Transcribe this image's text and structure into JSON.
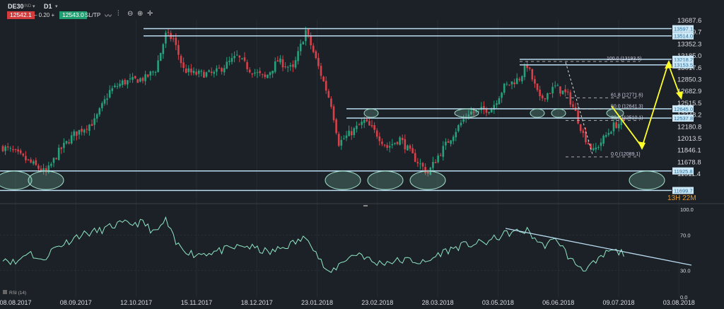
{
  "toolbar": {
    "symbol": "DE30",
    "market": "IND",
    "timeframe": "D1",
    "sell_price": "12542.1",
    "spread": "– 0.20 +",
    "buy_price": "12543.0",
    "sltp": "SL/TP"
  },
  "countdown": "13H 22M",
  "chart_data": [
    {
      "type": "candlestick",
      "title": "DE30 D1",
      "y_ticks": [
        "13687.6",
        "13519.7",
        "13352.3",
        "13185.0",
        "13017.6",
        "12850.3",
        "12682.9",
        "12515.5",
        "12348.2",
        "12180.8",
        "12013.5",
        "11846.1",
        "11678.8",
        "11511.4"
      ],
      "ylim": [
        11511.4,
        13687.6
      ],
      "x_ticks": [
        "08.08.2017",
        "08.09.2017",
        "12.10.2017",
        "15.11.2017",
        "18.12.2017",
        "23.01.2018",
        "23.02.2018",
        "28.03.2018",
        "03.05.2018",
        "06.06.2018",
        "09.07.2018",
        "03.08.2018"
      ],
      "close_waypoints": [
        [
          0,
          12200
        ],
        [
          4,
          12150
        ],
        [
          12,
          12000
        ],
        [
          17,
          11900
        ],
        [
          22,
          12150
        ],
        [
          28,
          12350
        ],
        [
          36,
          12500
        ],
        [
          42,
          12850
        ],
        [
          47,
          12950
        ],
        [
          56,
          13000
        ],
        [
          60,
          13100
        ],
        [
          64,
          13500
        ],
        [
          67,
          13450
        ],
        [
          71,
          13100
        ],
        [
          75,
          13050
        ],
        [
          83,
          13050
        ],
        [
          92,
          13250
        ],
        [
          97,
          13100
        ],
        [
          103,
          13000
        ],
        [
          108,
          13200
        ],
        [
          114,
          13100
        ],
        [
          119,
          13550
        ],
        [
          122,
          13300
        ],
        [
          129,
          12700
        ],
        [
          132,
          12250
        ],
        [
          136,
          12350
        ],
        [
          142,
          12500
        ],
        [
          147,
          12350
        ],
        [
          151,
          12200
        ],
        [
          156,
          12300
        ],
        [
          161,
          12100
        ],
        [
          167,
          11900
        ],
        [
          171,
          12100
        ],
        [
          178,
          12400
        ],
        [
          183,
          12600
        ],
        [
          192,
          12650
        ],
        [
          197,
          12900
        ],
        [
          203,
          13000
        ],
        [
          206,
          13150
        ],
        [
          211,
          12750
        ],
        [
          217,
          12900
        ],
        [
          222,
          12800
        ],
        [
          225,
          12600
        ],
        [
          228,
          12350
        ],
        [
          232,
          12150
        ],
        [
          236,
          12300
        ],
        [
          240,
          12450
        ],
        [
          244,
          12500
        ]
      ],
      "horizontal_levels": [
        {
          "label": "13597.1",
          "price": 13597.1
        },
        {
          "label": "13514.0",
          "price": 13514.0
        },
        {
          "label": "13218.2",
          "price": 13218.2
        },
        {
          "label": "13153.5",
          "price": 13153.5
        },
        {
          "label": "12645.0",
          "price": 12645.0
        },
        {
          "label": "12537.8",
          "price": 12537.8
        },
        {
          "label": "11925.8",
          "price": 11925.8
        },
        {
          "label": "11699.7",
          "price": 11699.7
        }
      ],
      "fibonacci": [
        {
          "label": "100.0 (13193.5)",
          "price": 13193.5
        },
        {
          "label": "61.8 (12771.6)",
          "price": 12771.6
        },
        {
          "label": "50.0 (12641.3)",
          "price": 12641.3
        },
        {
          "label": "38.2 (12510.1)",
          "price": 12510.1
        },
        {
          "label": "0.0 (12089.1)",
          "price": 12089.1
        }
      ],
      "colors": {
        "up": "#26a17b",
        "down": "#d8414a",
        "level": "#b9dcf0",
        "arrow": "#ffff2a"
      }
    },
    {
      "type": "line",
      "title": "RSI (14)",
      "y_ticks": [
        "100.0",
        "70.0",
        "30.0",
        "0.0"
      ],
      "ylim": [
        0,
        100
      ],
      "waypoints": [
        [
          0,
          45
        ],
        [
          5,
          38
        ],
        [
          10,
          52
        ],
        [
          15,
          40
        ],
        [
          20,
          55
        ],
        [
          25,
          62
        ],
        [
          30,
          70
        ],
        [
          38,
          75
        ],
        [
          45,
          82
        ],
        [
          55,
          84
        ],
        [
          60,
          72
        ],
        [
          64,
          87
        ],
        [
          68,
          60
        ],
        [
          75,
          48
        ],
        [
          85,
          52
        ],
        [
          95,
          58
        ],
        [
          105,
          50
        ],
        [
          115,
          62
        ],
        [
          120,
          68
        ],
        [
          124,
          45
        ],
        [
          128,
          25
        ],
        [
          134,
          42
        ],
        [
          140,
          50
        ],
        [
          146,
          38
        ],
        [
          152,
          40
        ],
        [
          160,
          42
        ],
        [
          166,
          38
        ],
        [
          172,
          50
        ],
        [
          180,
          58
        ],
        [
          190,
          62
        ],
        [
          198,
          72
        ],
        [
          206,
          75
        ],
        [
          212,
          58
        ],
        [
          218,
          65
        ],
        [
          223,
          42
        ],
        [
          228,
          32
        ],
        [
          233,
          38
        ],
        [
          238,
          52
        ],
        [
          244,
          50
        ]
      ],
      "color": "#8fe7c5"
    }
  ]
}
